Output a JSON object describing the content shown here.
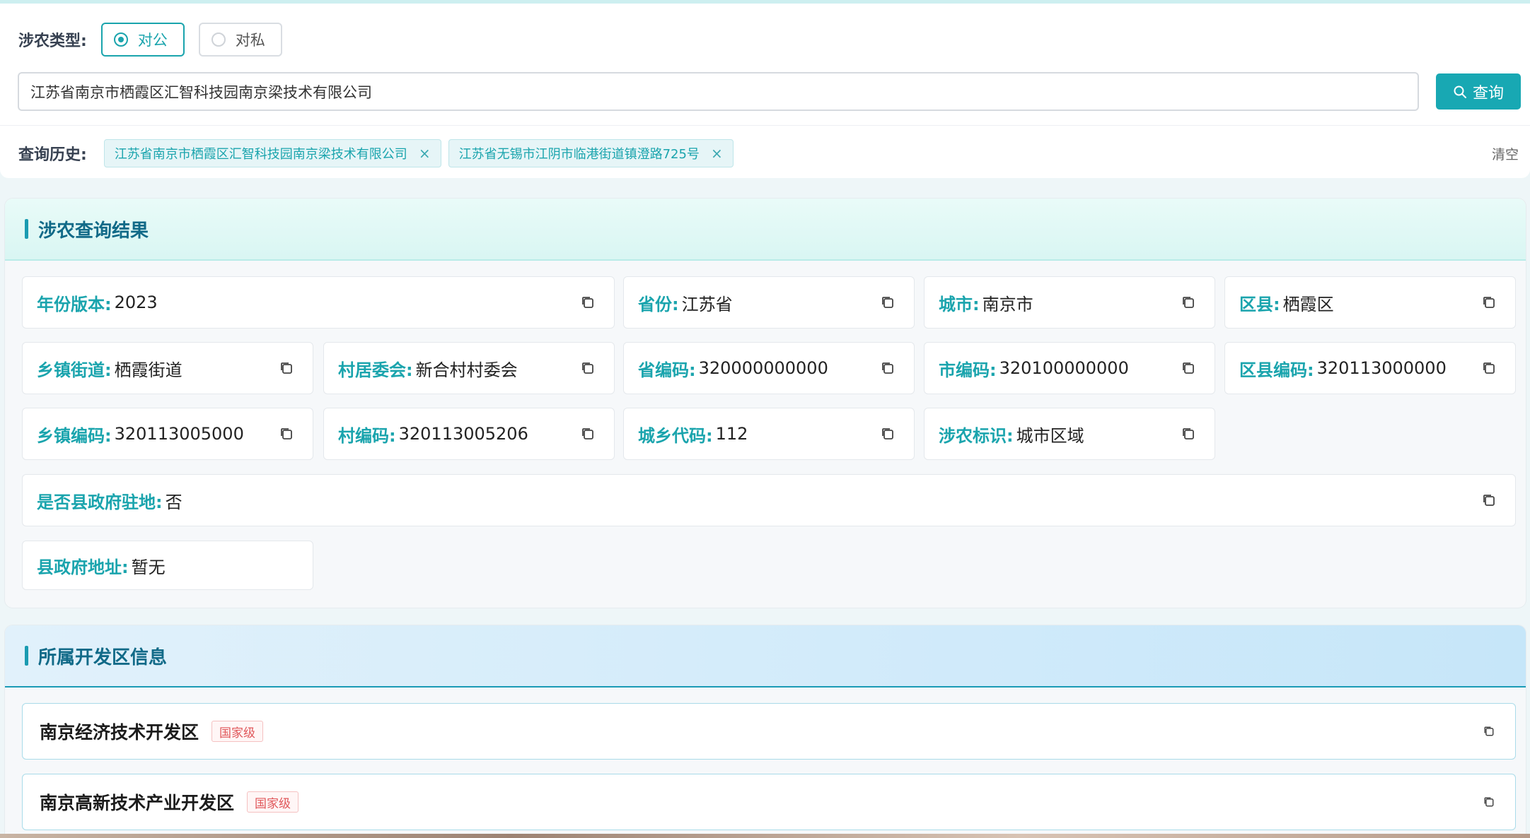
{
  "search": {
    "type_label": "涉农类型:",
    "options": [
      {
        "label": "对公",
        "selected": true
      },
      {
        "label": "对私",
        "selected": false
      }
    ],
    "query_value": "江苏省南京市栖霞区汇智科技园南京梁技术有限公司",
    "query_button": "查询",
    "history_label": "查询历史:",
    "history": [
      "江苏省南京市栖霞区汇智科技园南京梁技术有限公司",
      "江苏省无锡市江阴市临港街道镇澄路725号"
    ],
    "history_close": "×",
    "clear_label": "清空"
  },
  "result": {
    "title": "涉农查询结果",
    "fields": [
      {
        "key": "年份版本:",
        "value": "2023"
      },
      {
        "key": "省份:",
        "value": "江苏省"
      },
      {
        "key": "城市:",
        "value": "南京市"
      },
      {
        "key": "区县:",
        "value": "栖霞区"
      },
      {
        "key": "乡镇街道:",
        "value": "栖霞街道"
      },
      {
        "key": "村居委会:",
        "value": "新合村村委会"
      },
      {
        "key": "省编码:",
        "value": "320000000000"
      },
      {
        "key": "市编码:",
        "value": "320100000000"
      },
      {
        "key": "区县编码:",
        "value": "320113000000"
      },
      {
        "key": "乡镇编码:",
        "value": "320113005000"
      },
      {
        "key": "村编码:",
        "value": "320113005206"
      },
      {
        "key": "城乡代码:",
        "value": "112"
      },
      {
        "key": "涉农标识:",
        "value": "城市区域"
      },
      {
        "key": "是否县政府驻地:",
        "value": "否"
      },
      {
        "key": "县政府地址:",
        "value": "暂无"
      }
    ]
  },
  "devzone": {
    "title": "所属开发区信息",
    "items": [
      {
        "name": "南京经济技术开发区",
        "level": "国家级"
      },
      {
        "name": "南京高新技术产业开发区",
        "level": "国家级"
      }
    ]
  },
  "colors": {
    "accent": "#1aa4ad",
    "title": "#116a88",
    "tag_red": "#e0575a"
  }
}
